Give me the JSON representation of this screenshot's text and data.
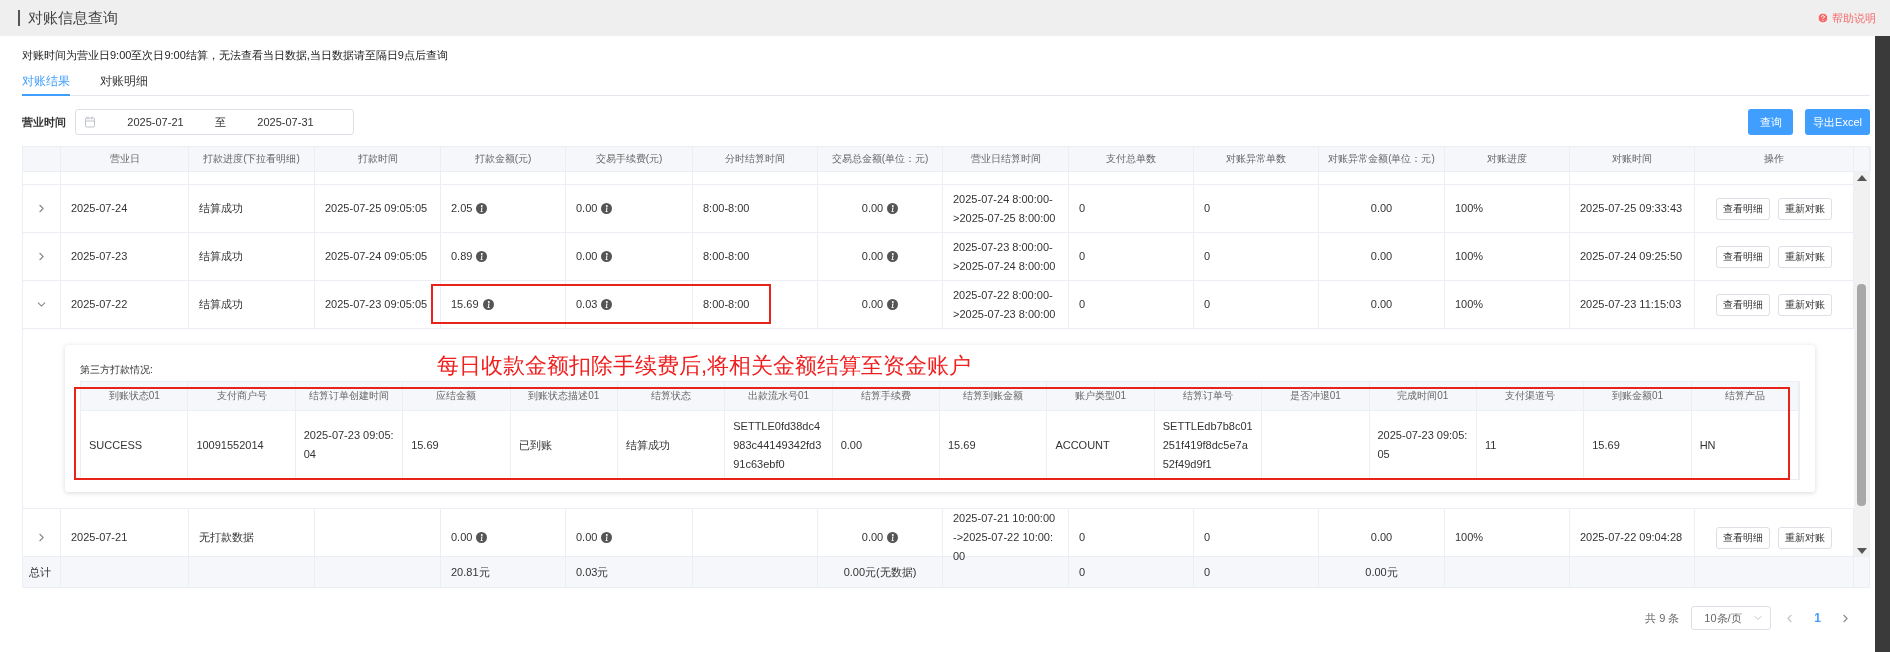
{
  "header": {
    "title": "对账信息查询",
    "help": "帮助说明"
  },
  "notice": "对账时间为营业日9:00至次日9:00结算，无法查看当日数据,当日数据请至隔日9点后查询",
  "tabs": [
    {
      "label": "对账结果",
      "selected": true
    },
    {
      "label": "对账明细",
      "selected": false
    }
  ],
  "filter": {
    "label": "营业时间",
    "start": "2025-07-21",
    "separator": "至",
    "end": "2025-07-31"
  },
  "buttons": [
    {
      "label": "查询"
    },
    {
      "label": "导出Excel"
    }
  ],
  "table": {
    "columns": [
      {
        "label": "营业日",
        "info": false
      },
      {
        "label": "打款进度(下拉看明细)",
        "info": false
      },
      {
        "label": "打款时间",
        "info": false
      },
      {
        "label": "打款金额(元)",
        "info": true
      },
      {
        "label": "交易手续费(元)",
        "info": true
      },
      {
        "label": "分时结算时间",
        "info": false
      },
      {
        "label": "交易总金额(单位：元)",
        "info": true
      },
      {
        "label": "营业日结算时间",
        "info": false
      },
      {
        "label": "支付总单数",
        "info": false
      },
      {
        "label": "对账异常单数",
        "info": false
      },
      {
        "label": "对账异常金额(单位：元)",
        "info": false
      },
      {
        "label": "对账进度",
        "info": false
      },
      {
        "label": "对账时间",
        "info": false
      },
      {
        "label": "操作",
        "info": false
      }
    ],
    "rows": [
      {
        "expanded": false,
        "highlighted": false,
        "cells": [
          "2025-07-24",
          "结算成功",
          "2025-07-25 09:05:05",
          "2.05",
          "0.00",
          "8:00-8:00",
          "0.00",
          "2025-07-24 8:00:00->2025-07-25 8:00:00",
          "0",
          "0",
          "0.00",
          "100%",
          "2025-07-25 09:33:43"
        ],
        "actions": [
          "查看明细",
          "重新对账"
        ]
      },
      {
        "expanded": false,
        "highlighted": false,
        "cells": [
          "2025-07-23",
          "结算成功",
          "2025-07-24 09:05:05",
          "0.89",
          "0.00",
          "8:00-8:00",
          "0.00",
          "2025-07-23 8:00:00->2025-07-24 8:00:00",
          "0",
          "0",
          "0.00",
          "100%",
          "2025-07-24 09:25:50"
        ],
        "actions": [
          "查看明细",
          "重新对账"
        ]
      },
      {
        "expanded": true,
        "highlighted": true,
        "cells": [
          "2025-07-22",
          "结算成功",
          "2025-07-23 09:05:05",
          "15.69",
          "0.03",
          "8:00-8:00",
          "0.00",
          "2025-07-22 8:00:00->2025-07-23 8:00:00",
          "0",
          "0",
          "0.00",
          "100%",
          "2025-07-23 11:15:03"
        ],
        "actions": [
          "查看明细",
          "重新对账"
        ],
        "detail": {
          "title": "第三方打款情况:",
          "note": "每日收款金额扣除手续费后,将相关金额结算至资金账户",
          "columns": [
            "到账状态01",
            "支付商户号",
            "结算订单创建时间",
            "应结金额",
            "到账状态描述01",
            "结算状态",
            "出款流水号01",
            "结算手续费",
            "结算到账金额",
            "账户类型01",
            "结算订单号",
            "是否冲退01",
            "完成时间01",
            "支付渠道号",
            "到账金额01",
            "结算产品"
          ],
          "rows": [
            [
              "SUCCESS",
              "10091552014",
              "2025-07-23 09:05:04",
              "15.69",
              "已到账",
              "结算成功",
              "SETTLE0fd38dc4983c44149342fd391c63ebf0",
              "0.00",
              "15.69",
              "ACCOUNT",
              "SETTLEdb7b8c01251f419f8dc5e7a52f49d9f1",
              null,
              "2025-07-23 09:05:05",
              "11",
              "15.69",
              "HN"
            ]
          ]
        }
      },
      {
        "expanded": false,
        "highlighted": false,
        "cells": [
          "2025-07-21",
          "无打款数据",
          null,
          "0.00",
          "0.00",
          null,
          "0.00",
          "2025-07-21 10:00:00->2025-07-22 10:00:00",
          "0",
          "0",
          "0.00",
          "100%",
          "2025-07-22 09:04:28"
        ],
        "actions": [
          "查看明细",
          "重新对账"
        ]
      }
    ],
    "total": {
      "label": "总计",
      "cells": [
        null,
        null,
        null,
        "20.81元",
        "0.03元",
        null,
        "0.00元(无数据)",
        null,
        "0",
        "0",
        "0.00元",
        null,
        null
      ]
    }
  },
  "pagination": {
    "total": "共 9 条",
    "page_size": "10条/页",
    "pages": [
      {
        "label": "1",
        "selected": true
      }
    ]
  }
}
